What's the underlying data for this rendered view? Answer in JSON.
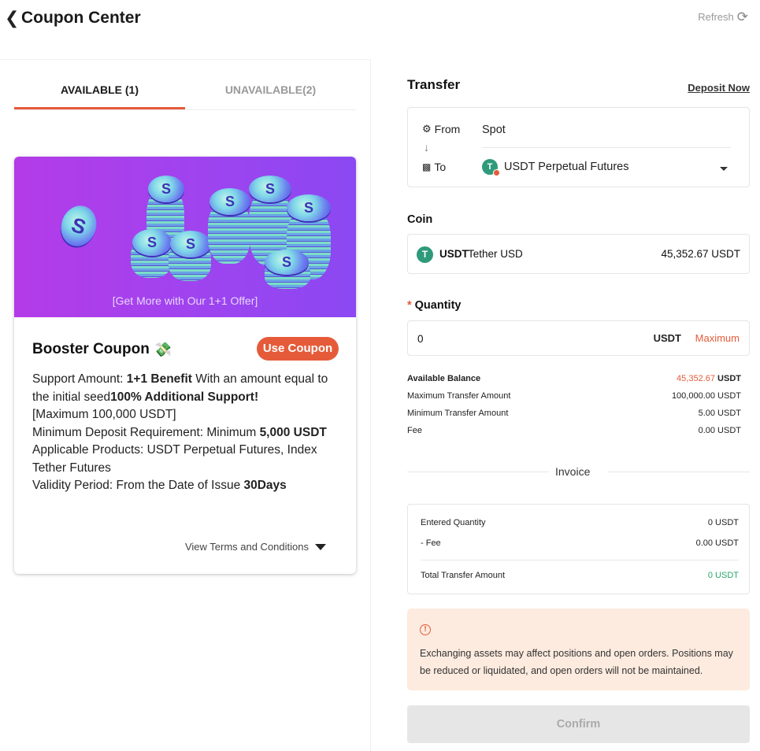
{
  "header": {
    "title": "Coupon Center",
    "refresh_label": "Refresh"
  },
  "tabs": [
    {
      "label": "AVAILABLE (1)",
      "active": true
    },
    {
      "label": "UNAVAILABLE(2)",
      "active": false
    }
  ],
  "coupon": {
    "banner_text": "[Get More with Our 1+1 Offer]",
    "name": "Booster Coupon",
    "use_button": "Use Coupon",
    "desc": {
      "support_prefix": "Support Amount: ",
      "support_bold": "1+1 Benefit",
      "support_mid": " With an amount equal to the initial seed",
      "support_bold2": "100% Additional Support!",
      "support_max": "[Maximum 100,000 USDT]",
      "min_deposit_prefix": "Minimum Deposit Requirement: Minimum ",
      "min_deposit_bold": "5,000 USDT",
      "products": "Applicable Products: USDT Perpetual Futures, Index Tether Futures",
      "validity_prefix": "Validity Period: From the Date of Issue ",
      "validity_bold": "30Days"
    },
    "terms_label": "View Terms and Conditions"
  },
  "transfer": {
    "title": "Transfer",
    "deposit_link": "Deposit Now",
    "from_label": "From",
    "from_value": "Spot",
    "to_label": "To",
    "to_value": "USDT Perpetual Futures"
  },
  "coin": {
    "label": "Coin",
    "symbol": "USDT",
    "name": "Tether USD",
    "balance": "45,352.67 USDT"
  },
  "quantity": {
    "label": "Quantity",
    "required_mark": "*",
    "value": "0",
    "unit": "USDT",
    "max_label": "Maximum"
  },
  "info": {
    "available_label": "Available Balance",
    "available_value": "45,352.67",
    "available_unit": "USDT",
    "max_label": "Maximum Transfer Amount",
    "max_value": "100,000.00 USDT",
    "min_label": "Minimum Transfer Amount",
    "min_value": "5.00 USDT",
    "fee_label": "Fee",
    "fee_value": "0.00 USDT"
  },
  "invoice": {
    "title": "Invoice",
    "entered_label": "Entered Quantity",
    "entered_value": "0 USDT",
    "fee_label": "- Fee",
    "fee_value": "0.00 USDT",
    "total_label": "Total Transfer Amount",
    "total_value": "0 USDT"
  },
  "warning": {
    "icon": "!",
    "text": "Exchanging assets may affect positions and open orders. Positions may be reduced or liquidated, and open orders will not be maintained."
  },
  "confirm_label": "Confirm",
  "icons": {
    "back": "chevron-left-icon",
    "refresh": "refresh-icon",
    "from": "wallet-icon",
    "to": "futures-wallet-icon",
    "coin": "usdt-logo-icon",
    "money": "money-wings-icon"
  },
  "colors": {
    "accent": "#e55b3a",
    "banner": "#9e44ef",
    "success": "#2aa56a",
    "warning_bg": "#fdebdf"
  }
}
